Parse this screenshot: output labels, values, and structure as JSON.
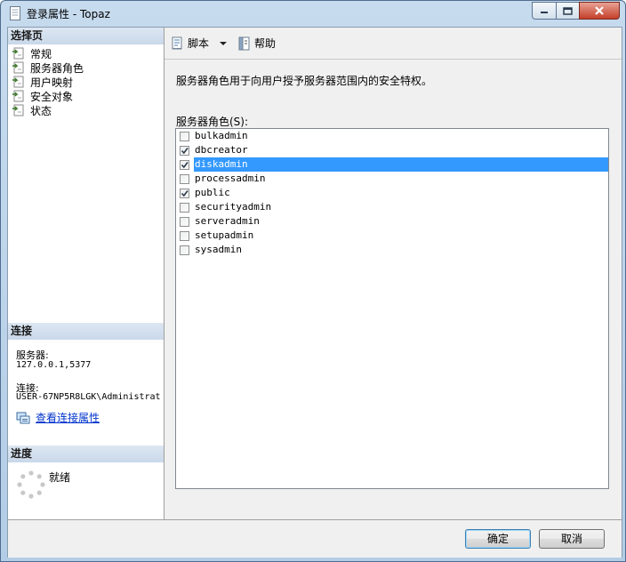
{
  "window": {
    "title": "登录属性 - Topaz"
  },
  "left": {
    "select_page_header": "选择页",
    "pages": [
      {
        "label": "常规"
      },
      {
        "label": "服务器角色"
      },
      {
        "label": "用户映射"
      },
      {
        "label": "安全对象"
      },
      {
        "label": "状态"
      }
    ],
    "connection_header": "连接",
    "server_label": "服务器:",
    "server_value": "127.0.0.1,5377",
    "connection_label": "连接:",
    "connection_value": "USER-67NP5R8LGK\\Administrat",
    "view_properties_link": "查看连接属性",
    "progress_header": "进度",
    "progress_status": "就绪"
  },
  "toolbar": {
    "script_label": "脚本",
    "help_label": "帮助"
  },
  "main": {
    "description": "服务器角色用于向用户授予服务器范围内的安全特权。",
    "roles_label": "服务器角色(S):",
    "roles": [
      {
        "name": "bulkadmin",
        "checked": false,
        "selected": false
      },
      {
        "name": "dbcreator",
        "checked": true,
        "selected": false
      },
      {
        "name": "diskadmin",
        "checked": true,
        "selected": true
      },
      {
        "name": "processadmin",
        "checked": false,
        "selected": false
      },
      {
        "name": "public",
        "checked": true,
        "selected": false
      },
      {
        "name": "securityadmin",
        "checked": false,
        "selected": false
      },
      {
        "name": "serveradmin",
        "checked": false,
        "selected": false
      },
      {
        "name": "setupadmin",
        "checked": false,
        "selected": false
      },
      {
        "name": "sysadmin",
        "checked": false,
        "selected": false
      }
    ]
  },
  "buttons": {
    "ok_label": "确定",
    "cancel_label": "取消"
  },
  "colors": {
    "selection": "#3399ff",
    "link": "#0033cc",
    "close_button": "#c43f2a"
  }
}
